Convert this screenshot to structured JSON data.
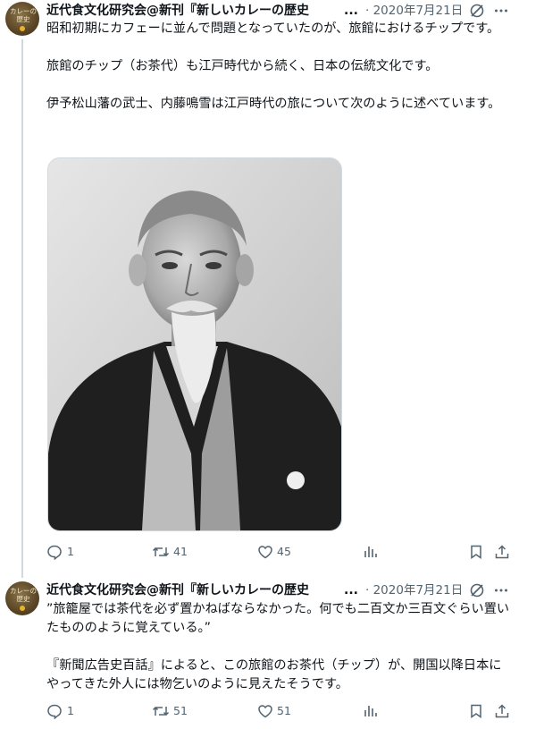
{
  "tweets": [
    {
      "avatar_label": "カレーの歴史",
      "author": "近代食文化研究会@新刊『新しいカレーの歴史",
      "ellipsis": "...",
      "date": "· 2020年7月21日",
      "text": "昭和初期にカフェーに並んで問題となっていたのが、旅館におけるチップです。\n\n旅館のチップ（お茶代）も江戸時代から続く、日本の伝統文化です。\n\n伊予松山藩の武士、内藤鳴雪は江戸時代の旅について次のように述べています。",
      "replies": "1",
      "retweets": "41",
      "likes": "45"
    },
    {
      "avatar_label": "カレーの歴史",
      "author": "近代食文化研究会@新刊『新しいカレーの歴史",
      "ellipsis": "...",
      "date": "· 2020年7月21日",
      "text": "”旅籠屋では茶代を必ず置かねばならなかった。何でも二百文か三百文ぐらい置いたもののように覚えている。”\n\n『新聞広告史百話』によると、この旅館のお茶代（チップ）が、開国以降日本にやってきた外人には物乞いのように見えたそうです。",
      "replies": "1",
      "retweets": "51",
      "likes": "51"
    }
  ],
  "icons": [
    "reply-icon",
    "retweet-icon",
    "like-icon",
    "views-icon",
    "bookmark-icon",
    "share-icon",
    "grok-icon",
    "more-icon"
  ],
  "colors": {
    "text": "#0f1419",
    "muted": "#536471",
    "thread": "#cfd9de"
  }
}
